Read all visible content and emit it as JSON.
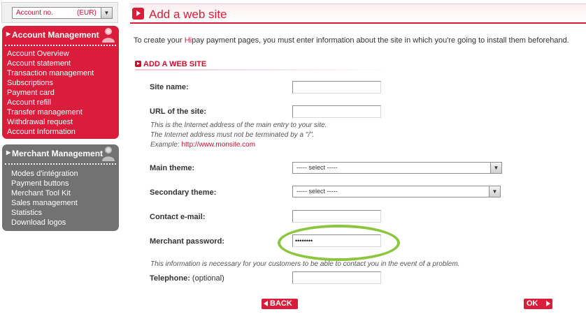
{
  "account": {
    "label": "Account no.",
    "currency": "(EUR)",
    "dropdown_icon": "chevron-down-icon"
  },
  "colors": {
    "brand_red": "#da1d3a",
    "menu_grey": "#727272",
    "highlight_ring": "#8cc63f"
  },
  "menus": {
    "account": {
      "title": "Account Management",
      "icon": "person-icon",
      "items": [
        "Account Overview",
        "Account statement",
        "Transaction management",
        "Subscriptions",
        "Payment card",
        "Account refill",
        "Transfer management",
        "Withdrawal request",
        "Account Information"
      ]
    },
    "merchant": {
      "title": "Merchant Management",
      "icon": "person-icon",
      "items": [
        "Modes d'intégration",
        "Payment buttons",
        "Merchant Tool Kit",
        "Sales management",
        "Statistics",
        "Download logos"
      ]
    }
  },
  "page": {
    "title": "Add a web site",
    "intro_before": "To create your ",
    "intro_highlight": "Hi",
    "intro_after": "pay payment pages, you must enter information about the site in which you're going to install them beforehand.",
    "section_title": "ADD A WEB SITE"
  },
  "form": {
    "site_name": {
      "label": "Site name:",
      "value": ""
    },
    "url": {
      "label": "URL of the site:",
      "value": "",
      "hint1": "This is the Internet address of the main entry to your site.",
      "hint2": "The Internet address must not be terminated by a \"/\".",
      "hint3_prefix": "Example: ",
      "hint3_link": "http://www.monsite.com"
    },
    "main_theme": {
      "label": "Main theme:",
      "selected": "----- select -----"
    },
    "secondary_theme": {
      "label": "Secondary theme:",
      "selected": "----- select -----"
    },
    "contact_email": {
      "label": "Contact e-mail:",
      "value": ""
    },
    "merchant_password": {
      "label": "Merchant password:",
      "value": "••••••••"
    },
    "contact_hint": "This information is necessary for your customers to be able to contact you in the event of a problem.",
    "telephone": {
      "label": "Telephone:",
      "optional": " (optional)",
      "value": ""
    }
  },
  "buttons": {
    "back": "BACK",
    "ok": "OK"
  }
}
